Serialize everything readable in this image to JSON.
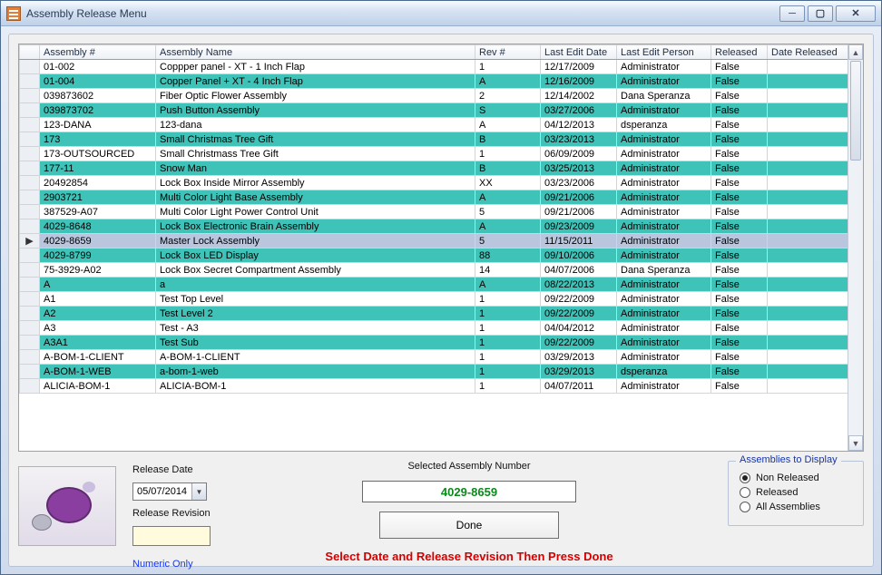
{
  "window": {
    "title": "Assembly Release Menu"
  },
  "columns": {
    "sel": "",
    "asm": "Assembly #",
    "name": "Assembly Name",
    "rev": "Rev #",
    "led": "Last Edit Date",
    "lep": "Last Edit Person",
    "rel": "Released",
    "dr": "Date Released"
  },
  "rows": [
    {
      "asm": "01-002",
      "name": "Coppper panel - XT - 1 Inch Flap",
      "rev": "1",
      "led": "12/17/2009",
      "lep": "Administrator",
      "rel": "False",
      "dr": ""
    },
    {
      "asm": "01-004",
      "name": "Copper Panel + XT - 4 Inch Flap",
      "rev": "A",
      "led": "12/16/2009",
      "lep": "Administrator",
      "rel": "False",
      "dr": ""
    },
    {
      "asm": "039873602",
      "name": "Fiber Optic Flower Assembly",
      "rev": "2",
      "led": "12/14/2002",
      "lep": "Dana Speranza",
      "rel": "False",
      "dr": ""
    },
    {
      "asm": "039873702",
      "name": "Push Button Assembly",
      "rev": "S",
      "led": "03/27/2006",
      "lep": "Administrator",
      "rel": "False",
      "dr": ""
    },
    {
      "asm": "123-DANA",
      "name": "123-dana",
      "rev": "A",
      "led": "04/12/2013",
      "lep": "dsperanza",
      "rel": "False",
      "dr": ""
    },
    {
      "asm": "173",
      "name": "Small Christmas Tree Gift",
      "rev": "B",
      "led": "03/23/2013",
      "lep": "Administrator",
      "rel": "False",
      "dr": ""
    },
    {
      "asm": "173-OUTSOURCED",
      "name": "Small Christmass Tree Gift",
      "rev": "1",
      "led": "06/09/2009",
      "lep": "Administrator",
      "rel": "False",
      "dr": ""
    },
    {
      "asm": "177-11",
      "name": "Snow Man",
      "rev": "B",
      "led": "03/25/2013",
      "lep": "Administrator",
      "rel": "False",
      "dr": ""
    },
    {
      "asm": "20492854",
      "name": "Lock Box Inside Mirror Assembly",
      "rev": "XX",
      "led": "03/23/2006",
      "lep": "Administrator",
      "rel": "False",
      "dr": ""
    },
    {
      "asm": "2903721",
      "name": "Multi Color Light Base Assembly",
      "rev": "A",
      "led": "09/21/2006",
      "lep": "Administrator",
      "rel": "False",
      "dr": ""
    },
    {
      "asm": "387529-A07",
      "name": "Multi Color Light Power Control Unit",
      "rev": "5",
      "led": "09/21/2006",
      "lep": "Administrator",
      "rel": "False",
      "dr": ""
    },
    {
      "asm": "4029-8648",
      "name": "Lock Box Electronic Brain Assembly",
      "rev": "A",
      "led": "09/23/2009",
      "lep": "Administrator",
      "rel": "False",
      "dr": ""
    },
    {
      "asm": "4029-8659",
      "name": "Master Lock Assembly",
      "rev": "5",
      "led": "11/15/2011",
      "lep": "Administrator",
      "rel": "False",
      "dr": ""
    },
    {
      "asm": "4029-8799",
      "name": "Lock Box LED Display",
      "rev": "88",
      "led": "09/10/2006",
      "lep": "Administrator",
      "rel": "False",
      "dr": ""
    },
    {
      "asm": "75-3929-A02",
      "name": "Lock Box Secret Compartment Assembly",
      "rev": "14",
      "led": "04/07/2006",
      "lep": "Dana Speranza",
      "rel": "False",
      "dr": ""
    },
    {
      "asm": "A",
      "name": "a",
      "rev": "A",
      "led": "08/22/2013",
      "lep": "Administrator",
      "rel": "False",
      "dr": ""
    },
    {
      "asm": "A1",
      "name": "Test Top Level",
      "rev": "1",
      "led": "09/22/2009",
      "lep": "Administrator",
      "rel": "False",
      "dr": ""
    },
    {
      "asm": "A2",
      "name": "Test Level 2",
      "rev": "1",
      "led": "09/22/2009",
      "lep": "Administrator",
      "rel": "False",
      "dr": ""
    },
    {
      "asm": "A3",
      "name": "Test - A3",
      "rev": "1",
      "led": "04/04/2012",
      "lep": "Administrator",
      "rel": "False",
      "dr": ""
    },
    {
      "asm": "A3A1",
      "name": "Test Sub",
      "rev": "1",
      "led": "09/22/2009",
      "lep": "Administrator",
      "rel": "False",
      "dr": ""
    },
    {
      "asm": "A-BOM-1-CLIENT",
      "name": "A-BOM-1-CLIENT",
      "rev": "1",
      "led": "03/29/2013",
      "lep": "Administrator",
      "rel": "False",
      "dr": ""
    },
    {
      "asm": "A-BOM-1-WEB",
      "name": "a-bom-1-web",
      "rev": "1",
      "led": "03/29/2013",
      "lep": "dsperanza",
      "rel": "False",
      "dr": ""
    },
    {
      "asm": "ALICIA-BOM-1",
      "name": "ALICIA-BOM-1",
      "rev": "1",
      "led": "04/07/2011",
      "lep": "Administrator",
      "rel": "False",
      "dr": ""
    }
  ],
  "selected_index": 12,
  "release": {
    "date_label": "Release Date",
    "date_value": "05/07/2014",
    "rev_label": "Release Revision",
    "numeric_hint": "Numeric Only"
  },
  "center": {
    "sel_label": "Selected Assembly Number",
    "sel_value": "4029-8659",
    "done_label": "Done",
    "instruction": "Select Date and Release Revision Then Press Done"
  },
  "filter": {
    "legend": "Assemblies to Display",
    "options": [
      "Non Released",
      "Released",
      "All Assemblies"
    ],
    "selected": 0
  }
}
